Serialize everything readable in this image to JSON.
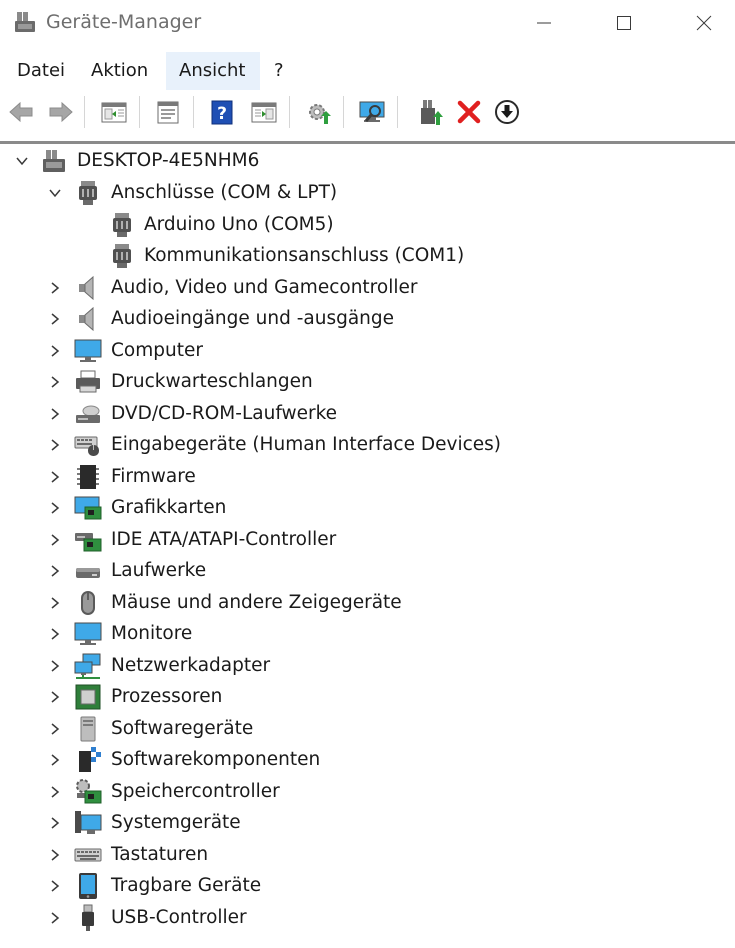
{
  "window": {
    "title": "Geräte-Manager"
  },
  "menu": {
    "items": [
      "Datei",
      "Aktion",
      "Ansicht",
      "?"
    ],
    "active": "Ansicht"
  },
  "tree": {
    "root": "DESKTOP-4E5NHM6",
    "expanded_category": {
      "label": "Anschlüsse (COM & LPT)",
      "children": [
        "Arduino Uno (COM5)",
        "Kommunikationsanschluss (COM1)"
      ]
    },
    "categories": [
      {
        "label": "Audio, Video und Gamecontroller",
        "icon": "speaker-icon"
      },
      {
        "label": "Audioeingänge und -ausgänge",
        "icon": "speaker-icon"
      },
      {
        "label": "Computer",
        "icon": "computer-icon"
      },
      {
        "label": "Druckwarteschlangen",
        "icon": "printer-icon"
      },
      {
        "label": "DVD/CD-ROM-Laufwerke",
        "icon": "dvd-drive-icon"
      },
      {
        "label": "Eingabegeräte (Human Interface Devices)",
        "icon": "hid-icon"
      },
      {
        "label": "Firmware",
        "icon": "firmware-chip-icon"
      },
      {
        "label": "Grafikkarten",
        "icon": "display-adapter-icon"
      },
      {
        "label": "IDE ATA/ATAPI-Controller",
        "icon": "ide-controller-icon"
      },
      {
        "label": "Laufwerke",
        "icon": "disk-drive-icon"
      },
      {
        "label": "Mäuse und andere Zeigegeräte",
        "icon": "mouse-icon"
      },
      {
        "label": "Monitore",
        "icon": "monitor-icon"
      },
      {
        "label": "Netzwerkadapter",
        "icon": "network-adapter-icon"
      },
      {
        "label": "Prozessoren",
        "icon": "processor-icon"
      },
      {
        "label": "Softwaregeräte",
        "icon": "software-device-icon"
      },
      {
        "label": "Softwarekomponenten",
        "icon": "software-component-icon"
      },
      {
        "label": "Speichercontroller",
        "icon": "storage-controller-icon"
      },
      {
        "label": "Systemgeräte",
        "icon": "system-device-icon"
      },
      {
        "label": "Tastaturen",
        "icon": "keyboard-icon"
      },
      {
        "label": "Tragbare Geräte",
        "icon": "portable-device-icon"
      },
      {
        "label": "USB-Controller",
        "icon": "usb-connector-icon"
      }
    ]
  },
  "toolbar": {
    "buttons": [
      "back-arrow-icon",
      "forward-arrow-icon",
      "show-hide-console-tree-icon",
      "properties-icon",
      "help-icon",
      "action-pane-icon",
      "update-driver-icon",
      "scan-hardware-icon",
      "enable-device-icon",
      "uninstall-device-icon",
      "download-driver-icon"
    ]
  }
}
